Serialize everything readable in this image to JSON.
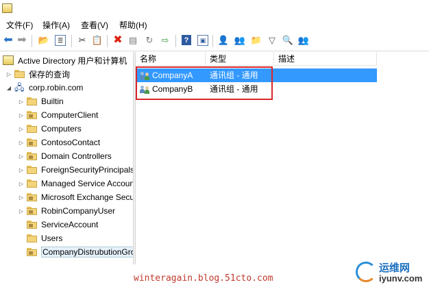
{
  "menubar": {
    "items": [
      "文件(F)",
      "操作(A)",
      "查看(V)",
      "帮助(H)"
    ]
  },
  "toolbar": {
    "icons": [
      "back-arrow-icon",
      "forward-arrow-icon",
      "up-folder-icon",
      "show-tree-icon",
      "cut-icon",
      "copy-icon",
      "delete-icon",
      "properties-icon",
      "refresh-icon",
      "export-icon",
      "help-icon",
      "console-icon",
      "new-user-icon",
      "new-group-icon",
      "new-ou-icon",
      "filter-icon",
      "find-icon",
      "add-to-group-icon"
    ]
  },
  "tree": {
    "root_label": "Active Directory 用户和计算机",
    "saved_queries": "保存的查询",
    "domain": "corp.robin.com",
    "children": [
      "Builtin",
      "ComputerClient",
      "Computers",
      "ContosoContact",
      "Domain Controllers",
      "ForeignSecurityPrincipals",
      "Managed Service Accounts",
      "Microsoft Exchange Security Groups",
      "RobinCompanyUser",
      "ServiceAccount",
      "Users",
      "CompanyDistrubutionGroup"
    ]
  },
  "list": {
    "columns": [
      "名称",
      "类型",
      "描述"
    ],
    "rows": [
      {
        "name": "CompanyA",
        "type": "通讯组 - 通用",
        "desc": ""
      },
      {
        "name": "CompanyB",
        "type": "通讯组 - 通用",
        "desc": ""
      }
    ]
  },
  "watermark": "winteragain.blog.51cto.com",
  "logo": {
    "cn": "运维网",
    "en": "iyunv.com"
  },
  "colors": {
    "selection": "#3399ff",
    "highlight_box": "#d9252b",
    "watermark": "#c0392b"
  }
}
